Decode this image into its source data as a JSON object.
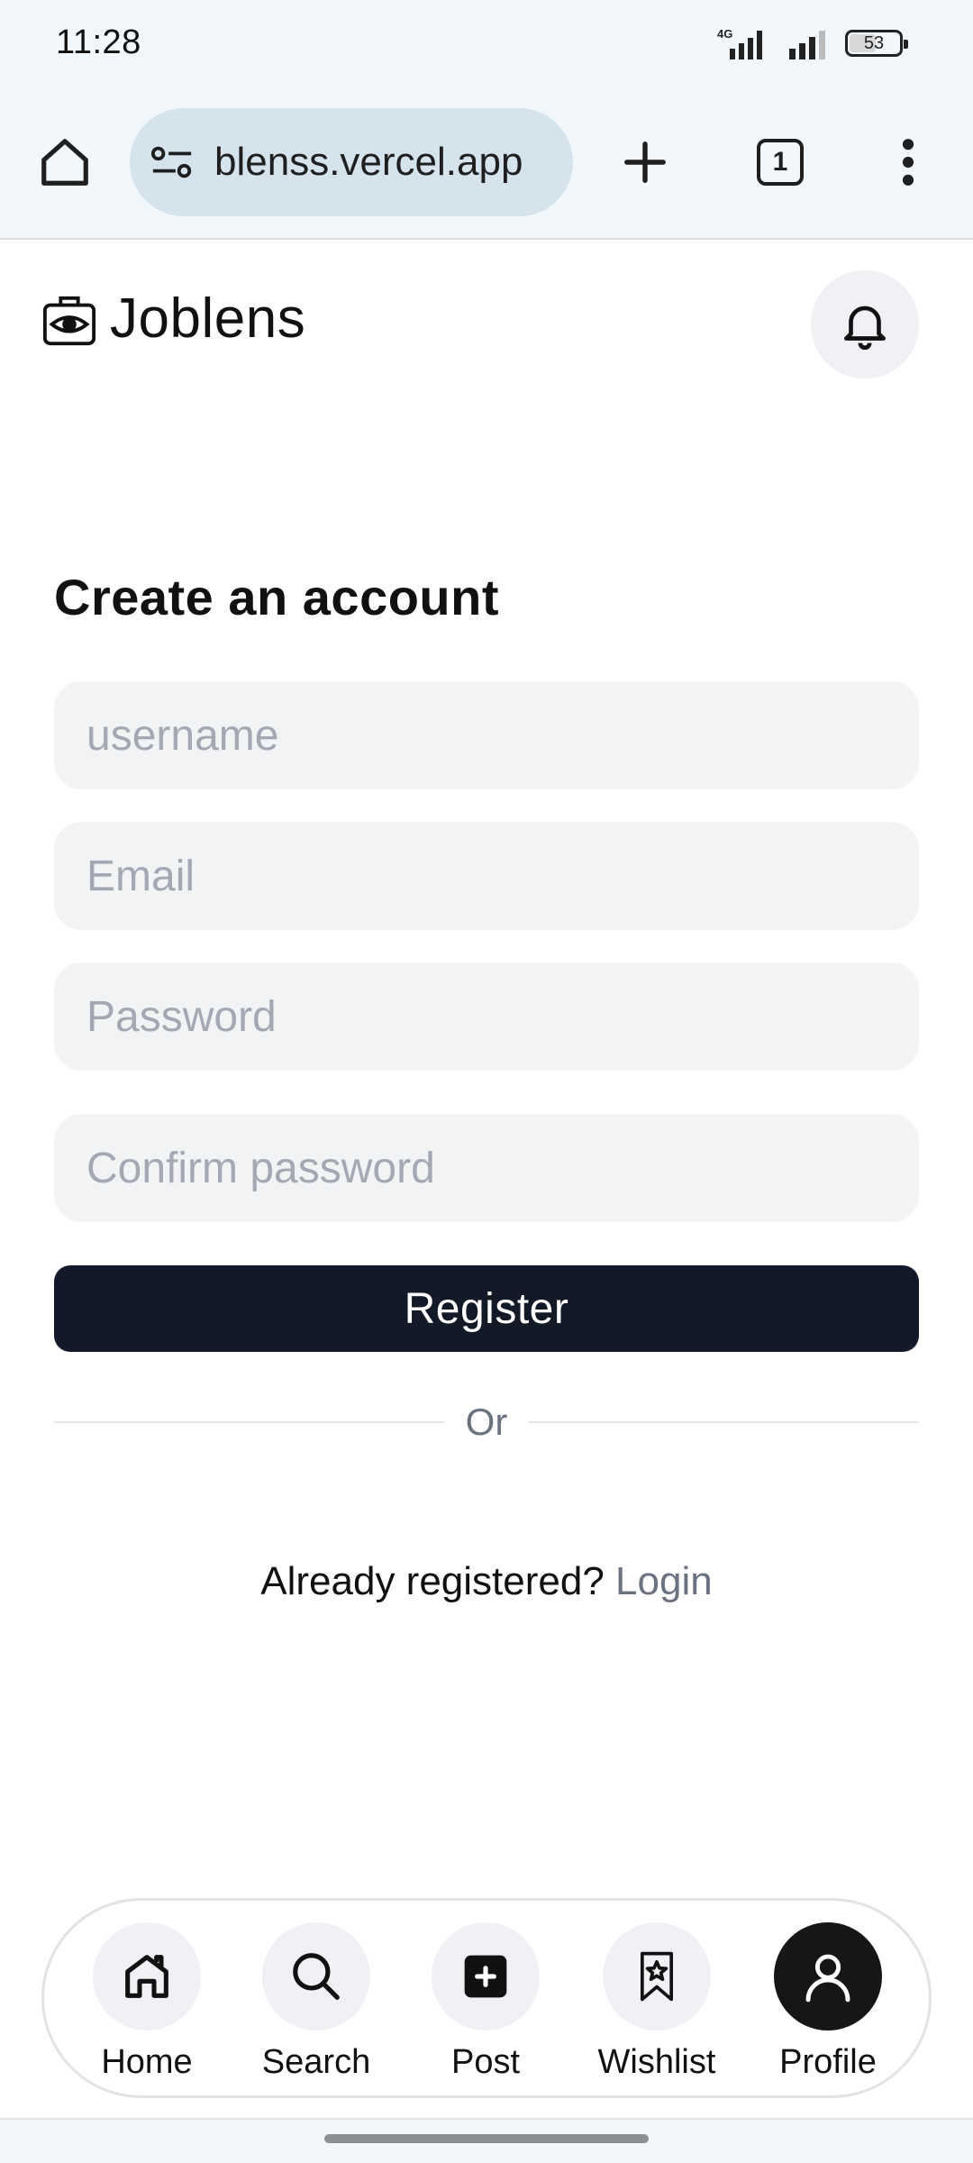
{
  "status_bar": {
    "time": "11:28",
    "network": "4G",
    "battery": "53"
  },
  "browser": {
    "url": "blenss.vercel.app",
    "tab_count": "1"
  },
  "header": {
    "app_name": "Joblens"
  },
  "form": {
    "title": "Create an account",
    "username_placeholder": "username",
    "email_placeholder": "Email",
    "password_placeholder": "Password",
    "confirm_placeholder": "Confirm password",
    "register_label": "Register",
    "divider_text": "Or",
    "already_registered": "Already registered?",
    "login_link": "Login"
  },
  "bottom_nav": {
    "items": [
      {
        "label": "Home",
        "icon": "home-icon"
      },
      {
        "label": "Search",
        "icon": "search-icon"
      },
      {
        "label": "Post",
        "icon": "plus-square-icon"
      },
      {
        "label": "Wishlist",
        "icon": "bookmark-star-icon"
      },
      {
        "label": "Profile",
        "icon": "user-icon",
        "active": true
      }
    ]
  },
  "colors": {
    "primary": "#131a27",
    "field_bg": "#f2f3f5",
    "browser_bg": "#f2f7fb",
    "url_pill": "#d5e3ec",
    "muted": "#6b7280"
  }
}
